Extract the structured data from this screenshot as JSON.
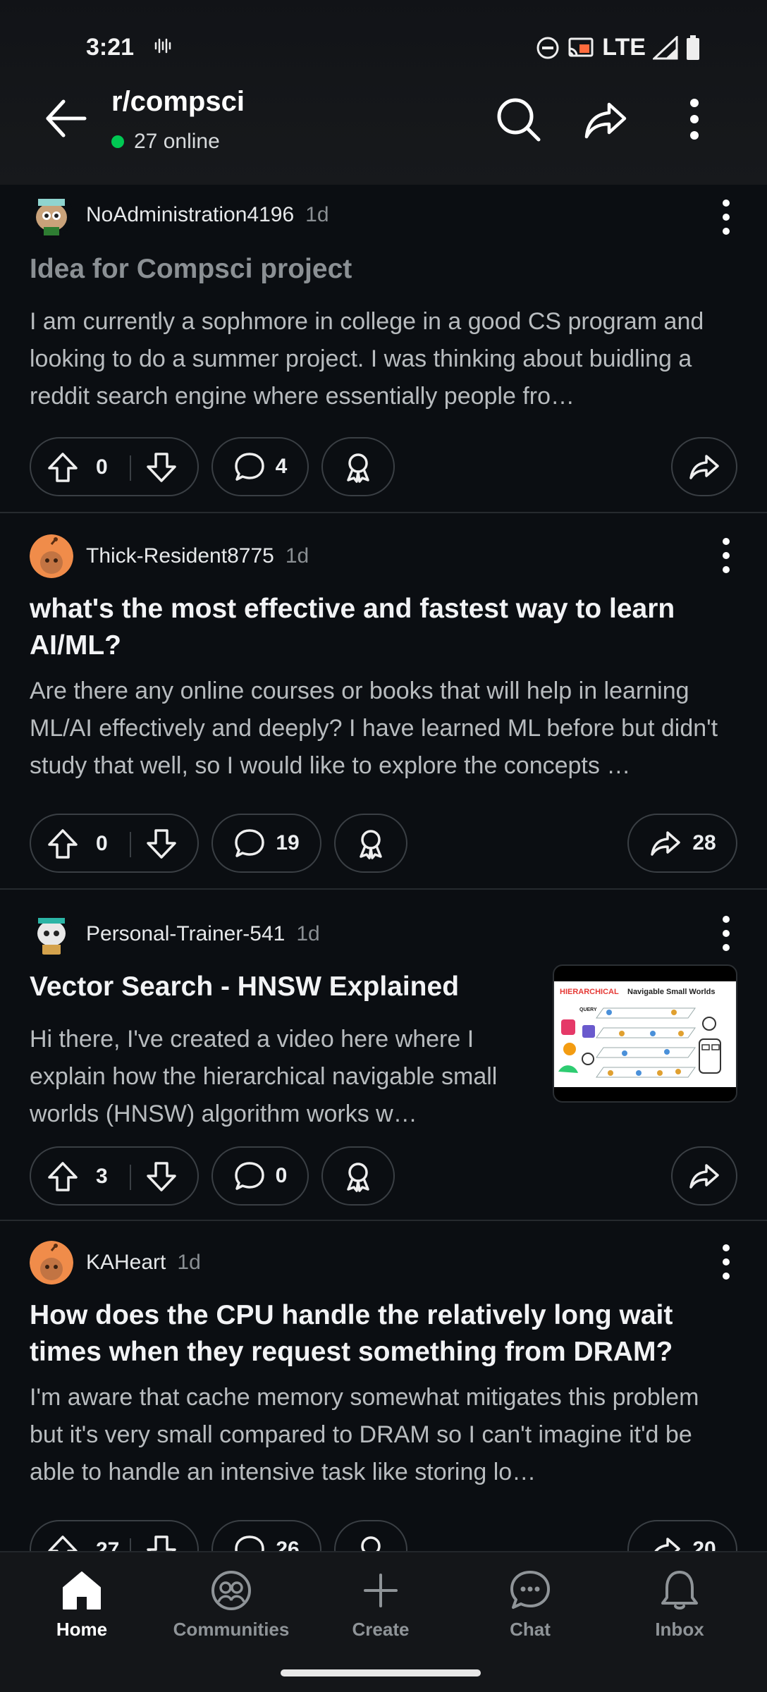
{
  "status_bar": {
    "time": "3:21",
    "network": "LTE"
  },
  "header": {
    "subreddit": "r/compsci",
    "online": "27 online"
  },
  "posts": [
    {
      "username": "NoAdministration4196",
      "age": "1d",
      "title": "Idea for Compsci project",
      "body": "I am currently a sophmore in college in a good CS program and looking to do a summer project. I was thinking about buidling a reddit search engine where essentially people fro…",
      "upvotes": "0",
      "comments": "4",
      "shares": ""
    },
    {
      "username": "Thick-Resident8775",
      "age": "1d",
      "title": "what's the most effective and fastest way to learn AI/ML?",
      "body": "Are there any online courses or books that will help in learning ML/AI effectively and deeply? I have learned ML before but didn't study that well, so I would like to explore the concepts …",
      "upvotes": "0",
      "comments": "19",
      "shares": "28"
    },
    {
      "username": "Personal-Trainer-541",
      "age": "1d",
      "title": "Vector Search - HNSW Explained",
      "body": "Hi there, I've created a video here where I explain how the hierarchical navigable small worlds (HNSW) algorithm works w…",
      "upvotes": "3",
      "comments": "0",
      "shares": "",
      "thumbnail": {
        "title_highlight": "HIERARCHICAL",
        "title_rest": " Navigable Small Worlds",
        "query_label": "QUERY"
      }
    },
    {
      "username": "KAHeart",
      "age": "1d",
      "title": "How does the CPU handle the relatively long wait times when they request something from DRAM?",
      "body": "I'm aware that cache memory somewhat mitigates this problem but it's very small compared to DRAM so I can't imagine it'd be able to handle an intensive task like storing lo…",
      "upvotes": "27",
      "comments": "26",
      "shares": "20"
    }
  ],
  "bottom_nav": {
    "items": [
      {
        "label": "Home"
      },
      {
        "label": "Communities"
      },
      {
        "label": "Create"
      },
      {
        "label": "Chat"
      },
      {
        "label": "Inbox"
      }
    ]
  },
  "colors": {
    "online_dot": "#00c853",
    "thumb_highlight": "#e53935"
  }
}
